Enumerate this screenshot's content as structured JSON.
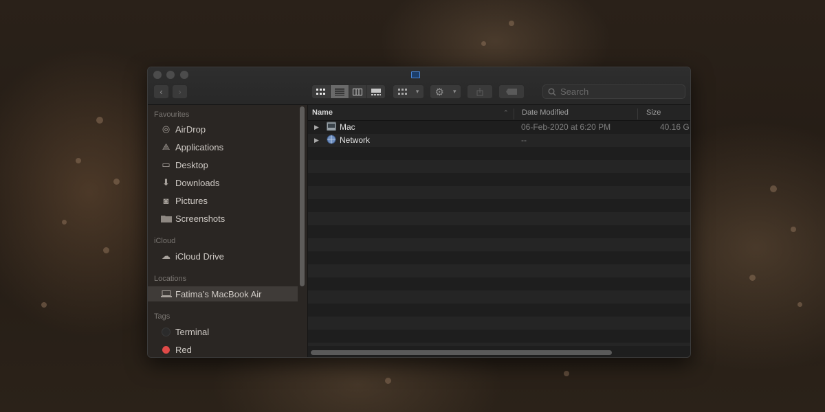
{
  "window": {
    "search_placeholder": "Search"
  },
  "sidebar": {
    "sections": [
      {
        "heading": "Favourites"
      },
      {
        "heading": "iCloud"
      },
      {
        "heading": "Locations"
      },
      {
        "heading": "Tags"
      }
    ],
    "favourites": [
      {
        "label": "AirDrop",
        "icon": "airdrop-icon"
      },
      {
        "label": "Applications",
        "icon": "applications-icon"
      },
      {
        "label": "Desktop",
        "icon": "desktop-icon"
      },
      {
        "label": "Downloads",
        "icon": "downloads-icon"
      },
      {
        "label": "Pictures",
        "icon": "camera-icon"
      },
      {
        "label": "Screenshots",
        "icon": "folder-icon"
      }
    ],
    "icloud": [
      {
        "label": "iCloud Drive",
        "icon": "cloud-icon"
      }
    ],
    "locations": [
      {
        "label": "Fatima’s MacBook Air",
        "icon": "laptop-icon",
        "selected": true
      }
    ],
    "tags": [
      {
        "label": "Terminal",
        "color": "#2b2b2b"
      },
      {
        "label": "Red",
        "color": "#e04a48"
      }
    ]
  },
  "columns": {
    "name": "Name",
    "date": "Date Modified",
    "size": "Size"
  },
  "files": [
    {
      "name": "Mac",
      "date": "06-Feb-2020 at 6:20 PM",
      "size": "40.16 G",
      "icon": "hard-drive-icon"
    },
    {
      "name": "Network",
      "date": "--",
      "size": "",
      "icon": "network-globe-icon"
    }
  ]
}
